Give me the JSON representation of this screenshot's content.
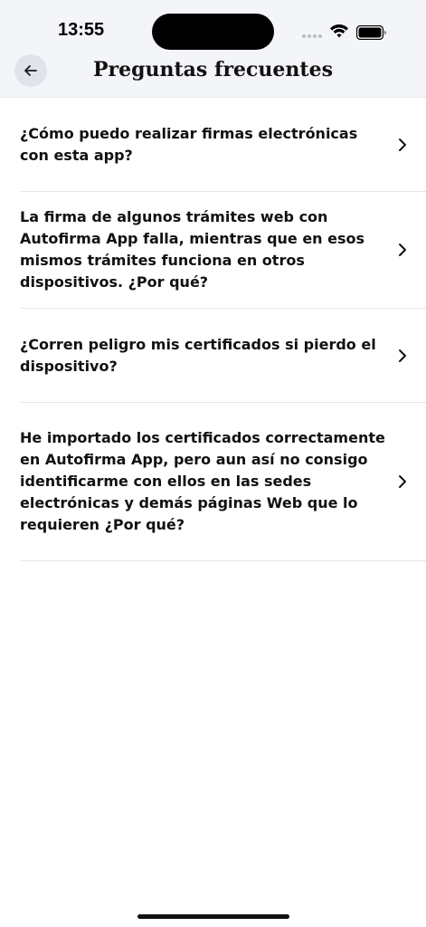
{
  "status_bar": {
    "time": "13:55",
    "icons": [
      "cellular-dots-icon",
      "wifi-icon",
      "battery-icon"
    ]
  },
  "header": {
    "back_icon": "arrow-left-icon",
    "title": "Preguntas frecuentes"
  },
  "faq": {
    "items": [
      {
        "question": "¿Cómo puedo realizar firmas electrónicas con esta app?"
      },
      {
        "question": "La firma de algunos trámites web con Autofirma App falla, mientras que en esos mismos trámites funciona en otros dispositivos. ¿Por qué?"
      },
      {
        "question": "¿Corren peligro mis certificados si pierdo el dispositivo?"
      },
      {
        "question": "He importado los certificados correctamente en Autofirma App, pero aun así no consigo identificarme con ellos en las sedes electrónicas y demás páginas Web que lo requieren ¿Por qué?"
      }
    ],
    "chevron_icon": "chevron-right-icon"
  },
  "colors": {
    "header_background": "#f3f5f9",
    "back_button_background": "#dfe4ec",
    "divider": "#e6e7ea",
    "text": "#111111"
  }
}
